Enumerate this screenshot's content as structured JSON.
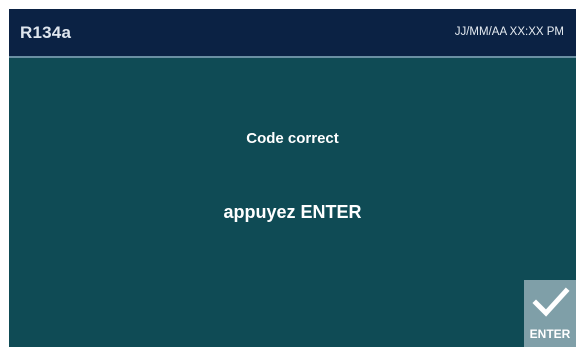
{
  "header": {
    "title": "R134a",
    "datetime": "JJ/MM/AA XX:XX PM"
  },
  "main": {
    "message_line1": "Code correct",
    "message_line2": "appuyez ENTER"
  },
  "buttons": {
    "enter_label": "ENTER",
    "enter_icon": "check-icon"
  },
  "colors": {
    "background": "#0f4b55",
    "header": "#0b2244",
    "button": "#7f9fa8",
    "text": "#ffffff"
  }
}
